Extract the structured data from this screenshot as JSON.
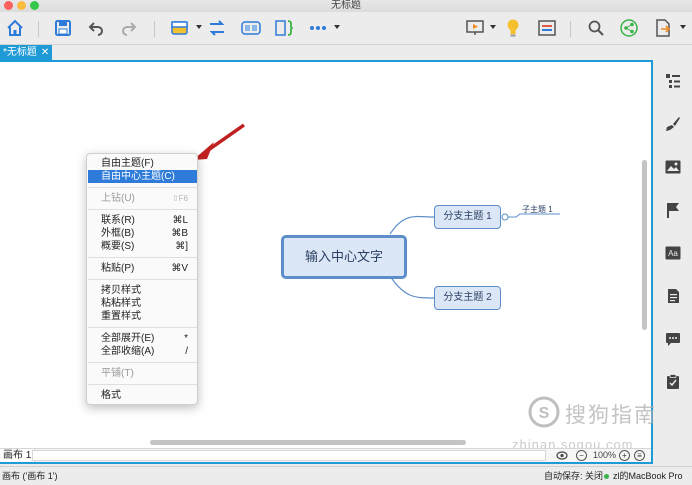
{
  "window": {
    "title": "无标题"
  },
  "toolbar": {
    "items": [
      "home-icon",
      "save-icon",
      "undo-icon",
      "redo-icon",
      "topic-icon",
      "relationship-icon",
      "boundary-icon",
      "summary-icon",
      "more-icon",
      "presentation-icon",
      "idea-icon",
      "outline-icon",
      "search-icon",
      "share-icon",
      "export-icon"
    ]
  },
  "tab": {
    "label": "*无标题",
    "close": "✕"
  },
  "mindmap": {
    "central": "输入中心文字",
    "branches": [
      "分支主题 1",
      "分支主题 2"
    ],
    "subtopic": "子主题 1"
  },
  "context_menu": {
    "items": [
      {
        "label": "自由主题(F)",
        "shortcut": "",
        "state": "normal"
      },
      {
        "label": "自由中心主题(C)",
        "shortcut": "",
        "state": "selected"
      },
      {
        "label": "上钻(U)",
        "shortcut": "⇧F6",
        "state": "disabled"
      },
      {
        "label": "联系(R)",
        "shortcut": "⌘L",
        "state": "normal"
      },
      {
        "label": "外框(B)",
        "shortcut": "⌘B",
        "state": "normal"
      },
      {
        "label": "概要(S)",
        "shortcut": "⌘]",
        "state": "normal"
      },
      {
        "label": "粘贴(P)",
        "shortcut": "⌘V",
        "state": "normal"
      },
      {
        "label": "拷贝样式",
        "shortcut": "",
        "state": "normal"
      },
      {
        "label": "粘粘样式",
        "shortcut": "",
        "state": "normal"
      },
      {
        "label": "重置样式",
        "shortcut": "",
        "state": "normal"
      },
      {
        "label": "全部展开(E)",
        "shortcut": "*",
        "state": "normal"
      },
      {
        "label": "全部收缩(A)",
        "shortcut": "/",
        "state": "normal"
      },
      {
        "label": "平铺(T)",
        "shortcut": "",
        "state": "disabled"
      },
      {
        "label": "格式",
        "shortcut": "",
        "state": "normal"
      }
    ]
  },
  "sheetbar": {
    "tab_label": "画布 1",
    "zoom": "100%"
  },
  "statusbar": {
    "left": "画布 ('画布 1')",
    "autosave": "自动保存: 关闭",
    "device": "zl的MacBook Pro"
  },
  "sidepanel": {
    "items": [
      "outline-view-icon",
      "style-brush-icon",
      "image-icon",
      "marker-flag-icon",
      "text-format-icon",
      "notes-icon",
      "comment-icon",
      "task-icon"
    ]
  },
  "watermark": {
    "text": "搜狗指南",
    "url": "zhinan.sogou.com"
  },
  "colors": {
    "accent": "#1e9ad6",
    "topic_border": "#5c8fc9",
    "topic_fill": "#dbe7f6",
    "menu_highlight": "#2f7bd9",
    "arrow": "#c0201f"
  }
}
